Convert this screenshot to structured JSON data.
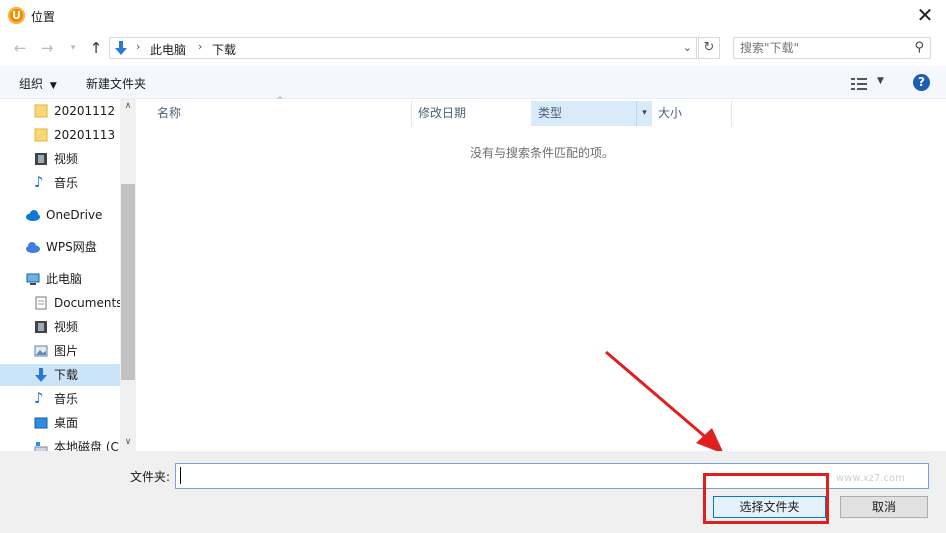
{
  "window": {
    "title": "位置",
    "logo_letter": "U"
  },
  "address": {
    "crumbs": [
      "此电脑",
      "下载"
    ]
  },
  "search": {
    "placeholder": "搜索\"下载\""
  },
  "toolbar": {
    "organize_label": "组织",
    "new_folder_label": "新建文件夹"
  },
  "sidebar": {
    "items": [
      {
        "label": "20201112",
        "icon": "folder-icon"
      },
      {
        "label": "20201113",
        "icon": "folder-icon"
      },
      {
        "label": "视频",
        "icon": "video-icon"
      },
      {
        "label": "音乐",
        "icon": "music-icon"
      },
      {
        "label": "OneDrive",
        "icon": "cloud-icon"
      },
      {
        "label": "WPS网盘",
        "icon": "wps-cloud-icon"
      },
      {
        "label": "此电脑",
        "icon": "computer-icon"
      },
      {
        "label": "Documents",
        "icon": "document-icon"
      },
      {
        "label": "视频",
        "icon": "video-icon"
      },
      {
        "label": "图片",
        "icon": "picture-icon"
      },
      {
        "label": "下载",
        "icon": "download-icon"
      },
      {
        "label": "音乐",
        "icon": "music-icon"
      },
      {
        "label": "桌面",
        "icon": "desktop-icon"
      },
      {
        "label": "本地磁盘 (C",
        "icon": "drive-icon"
      }
    ]
  },
  "columns": [
    "名称",
    "修改日期",
    "类型",
    "大小"
  ],
  "empty_message": "没有与搜索条件匹配的项。",
  "bottom": {
    "folder_label": "文件夹:",
    "folder_value": "",
    "select_label": "选择文件夹",
    "cancel_label": "取消"
  },
  "watermark": "www.xz7.com",
  "colors": {
    "accent": "#0078d7",
    "highlight": "#e01f1f",
    "selected": "#cce4f7"
  }
}
